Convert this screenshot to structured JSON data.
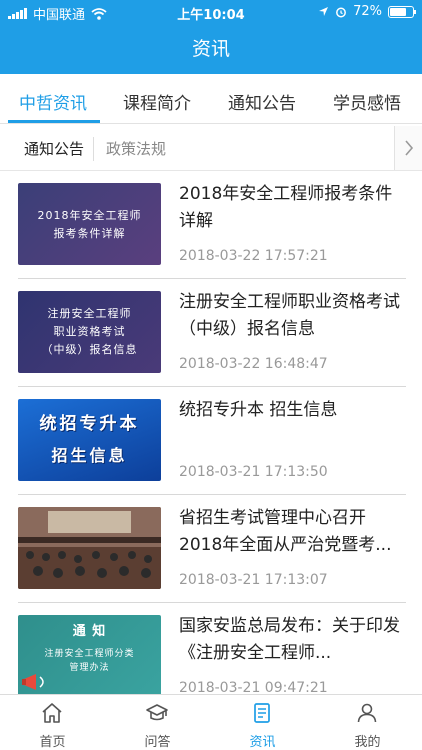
{
  "status_bar": {
    "carrier": "中国联通",
    "time": "上午10:04",
    "battery": "72%",
    "battery_level": 0.72
  },
  "nav": {
    "title": "资讯"
  },
  "tabs": [
    {
      "label": "中哲资讯",
      "active": true
    },
    {
      "label": "课程简介",
      "active": false
    },
    {
      "label": "通知公告",
      "active": false
    },
    {
      "label": "学员感悟",
      "active": false
    }
  ],
  "subtabs": [
    {
      "label": "通知公告",
      "active": true
    },
    {
      "label": "政策法规",
      "active": false
    }
  ],
  "news": [
    {
      "thumb_lines": [
        "2018年安全工程师",
        "报考条件详解"
      ],
      "title": "2018年安全工程师报考条件详解",
      "date": "2018-03-22 17:57:21"
    },
    {
      "thumb_lines": [
        "注册安全工程师",
        "职业资格考试",
        "（中级）报名信息"
      ],
      "title": "注册安全工程师职业资格考试（中级）报名信息",
      "date": "2018-03-22 16:48:47"
    },
    {
      "thumb_lines": [
        "统招专升本",
        "招生信息"
      ],
      "title": "统招专升本 招生信息",
      "date": "2018-03-21 17:13:50"
    },
    {
      "thumb_lines": [],
      "title": "省招生考试管理中心召开2018年全面从严治党暨考...",
      "date": "2018-03-21 17:13:07"
    },
    {
      "thumb_lines": [
        "通  知",
        "注册安全工程师分类",
        "管理办法"
      ],
      "title": "国家安监总局发布：关于印发《注册安全工程师...",
      "date": "2018-03-21 09:47:21"
    }
  ],
  "bottom_tabs": [
    {
      "label": "首页",
      "icon": "home-icon"
    },
    {
      "label": "问答",
      "icon": "graduation-cap-icon"
    },
    {
      "label": "资讯",
      "icon": "news-icon",
      "active": true
    },
    {
      "label": "我的",
      "icon": "user-icon"
    }
  ],
  "colors": {
    "primary": "#1f9ee6",
    "text": "#222222",
    "muted": "#999999"
  }
}
